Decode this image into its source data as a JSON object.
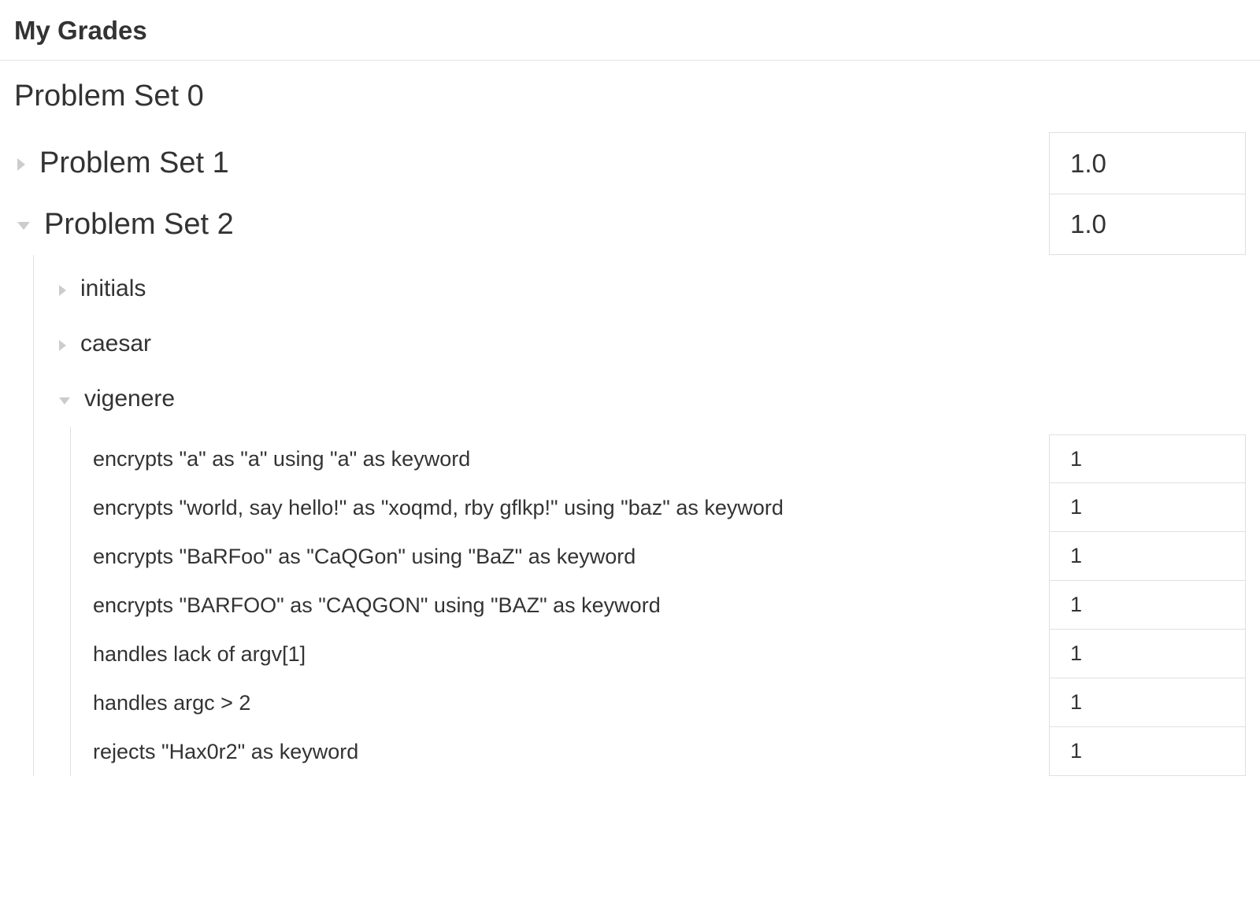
{
  "header": {
    "title": "My Grades"
  },
  "sets": {
    "pset0": {
      "title": "Problem Set 0"
    },
    "pset1": {
      "title": "Problem Set 1",
      "grade": "1.0"
    },
    "pset2": {
      "title": "Problem Set 2",
      "grade": "1.0",
      "subs": {
        "initials": {
          "title": "initials"
        },
        "caesar": {
          "title": "caesar"
        },
        "vigenere": {
          "title": "vigenere",
          "tests": [
            {
              "desc": "encrypts \"a\" as \"a\" using \"a\" as keyword",
              "grade": "1"
            },
            {
              "desc": "encrypts \"world, say hello!\" as \"xoqmd, rby gflkp!\" using \"baz\" as keyword",
              "grade": "1"
            },
            {
              "desc": "encrypts \"BaRFoo\" as \"CaQGon\" using \"BaZ\" as keyword",
              "grade": "1"
            },
            {
              "desc": "encrypts \"BARFOO\" as \"CAQGON\" using \"BAZ\" as keyword",
              "grade": "1"
            },
            {
              "desc": "handles lack of argv[1]",
              "grade": "1"
            },
            {
              "desc": "handles argc > 2",
              "grade": "1"
            },
            {
              "desc": "rejects \"Hax0r2\" as keyword",
              "grade": "1"
            }
          ]
        }
      }
    }
  }
}
